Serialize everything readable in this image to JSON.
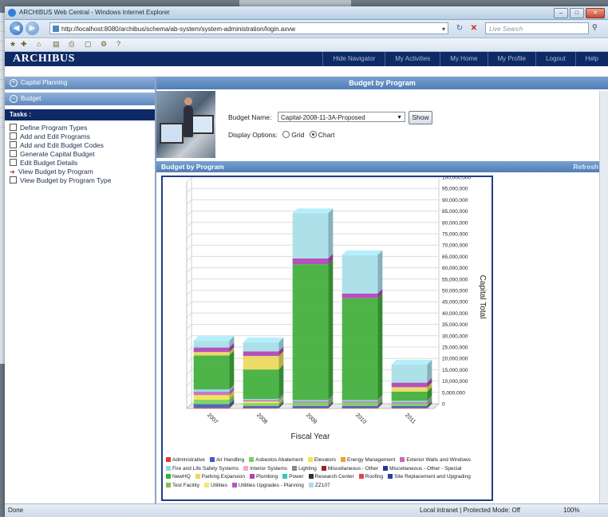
{
  "browser": {
    "title": "ARCHIBUS Web Central - Windows Internet Explorer",
    "url": "http://localhost:8080/archibus/schema/ab-system/system-administration/login.axvw",
    "search_placeholder": "Live Search"
  },
  "app": {
    "brand": "ARCHIBUS",
    "topnav": [
      "Hide Navigator",
      "My Activities",
      "My Home",
      "My Profile",
      "Logout",
      "Help"
    ]
  },
  "nav": {
    "sections": [
      "Capital Planning",
      "Budget"
    ],
    "tasks_header": "Tasks :",
    "tasks": [
      "Define Program Types",
      "Add and Edit Programs",
      "Add and Edit Budget Codes",
      "Generate Capital Budget",
      "Edit Budget Details",
      "View Budget by Program",
      "View Budget by Program Type"
    ]
  },
  "panel": {
    "title": "Budget by Program",
    "budget_name_label": "Budget Name:",
    "budget_name_value": "Capital-2008-11-3A-Proposed",
    "show_button": "Show",
    "display_options_label": "Display Options:",
    "opt_grid": "Grid",
    "opt_chart": "Chart",
    "chart_panel_title": "Budget by Program",
    "refresh": "Refresh"
  },
  "chart_data": {
    "type": "bar",
    "stacked": true,
    "categories": [
      "2007",
      "2008",
      "2009",
      "2010",
      "2011"
    ],
    "xlabel": "Fiscal Year",
    "ylabel": "Capital Total",
    "ylim": [
      0,
      100000000
    ],
    "ytick_step": 5000000,
    "series": [
      {
        "name": "Administrative",
        "color": "#e03a2e",
        "values": [
          400000,
          300000,
          300000,
          300000,
          300000
        ]
      },
      {
        "name": "Air Handling",
        "color": "#3a5cc4",
        "values": [
          1500000,
          800000,
          800000,
          800000,
          800000
        ]
      },
      {
        "name": "Asbestos Abatement",
        "color": "#7ad15a",
        "values": [
          2000000,
          1200000,
          1500000,
          1500000,
          1200000
        ]
      },
      {
        "name": "Elevators",
        "color": "#f2e34a",
        "values": [
          2000000,
          800000,
          0,
          0,
          0
        ]
      },
      {
        "name": "Exterior Walls and Windows",
        "color": "#c56ac2",
        "values": [
          1500000,
          600000,
          600000,
          600000,
          600000
        ]
      },
      {
        "name": "Fire and Life Safety Systems",
        "color": "#8fd8e6",
        "values": [
          1000000,
          500000,
          500000,
          500000,
          500000
        ]
      },
      {
        "name": "NewHQ",
        "color": "#3fae3a",
        "values": [
          15000000,
          13000000,
          60000000,
          45000000,
          4000000
        ]
      },
      {
        "name": "Parking Expansion",
        "color": "#ead85a",
        "values": [
          1500000,
          6000000,
          0,
          0,
          2000000
        ]
      },
      {
        "name": "Plumbing",
        "color": "#b042b6",
        "values": [
          2000000,
          2000000,
          2500000,
          2000000,
          2000000
        ]
      },
      {
        "name": "ZZ107",
        "color": "#a7dde8",
        "values": [
          3000000,
          4000000,
          20000000,
          17000000,
          8000000
        ]
      }
    ]
  },
  "legend": [
    {
      "name": "Administrative",
      "color": "#e03a2e"
    },
    {
      "name": "Air Handling",
      "color": "#3a5cc4"
    },
    {
      "name": "Asbestos Abatement",
      "color": "#7ad15a"
    },
    {
      "name": "Elevators",
      "color": "#f2e34a"
    },
    {
      "name": "Energy Management",
      "color": "#f0a030"
    },
    {
      "name": "Exterior Walls and Windows",
      "color": "#c56ac2"
    },
    {
      "name": "Fire and Life Safety Systems",
      "color": "#8fd8e6"
    },
    {
      "name": "Interior Systems",
      "color": "#f3a8c8"
    },
    {
      "name": "Lighting",
      "color": "#8a8a8a"
    },
    {
      "name": "Miscellaneous - Other",
      "color": "#a31d2a"
    },
    {
      "name": "Miscellaneous - Other - Special",
      "color": "#27378f"
    },
    {
      "name": "NewHQ",
      "color": "#3fae3a"
    },
    {
      "name": "Parking Expansion",
      "color": "#ead85a"
    },
    {
      "name": "Plumbing",
      "color": "#b042b6"
    },
    {
      "name": "Power",
      "color": "#3cc5b5"
    },
    {
      "name": "Research Center",
      "color": "#333333"
    },
    {
      "name": "Roofing",
      "color": "#e04545"
    },
    {
      "name": "Site Replacement and Upgrading",
      "color": "#2c3f9e"
    },
    {
      "name": "Test Facility",
      "color": "#7fc24a"
    },
    {
      "name": "Utilities",
      "color": "#f4ea6a"
    },
    {
      "name": "Utilities Upgrades - Planning",
      "color": "#b75ab6"
    },
    {
      "name": "ZZ107",
      "color": "#a7dde8"
    }
  ],
  "status": {
    "left": "Done",
    "zone": "Local intranet | Protected Mode: Off",
    "zoom": "100%"
  }
}
